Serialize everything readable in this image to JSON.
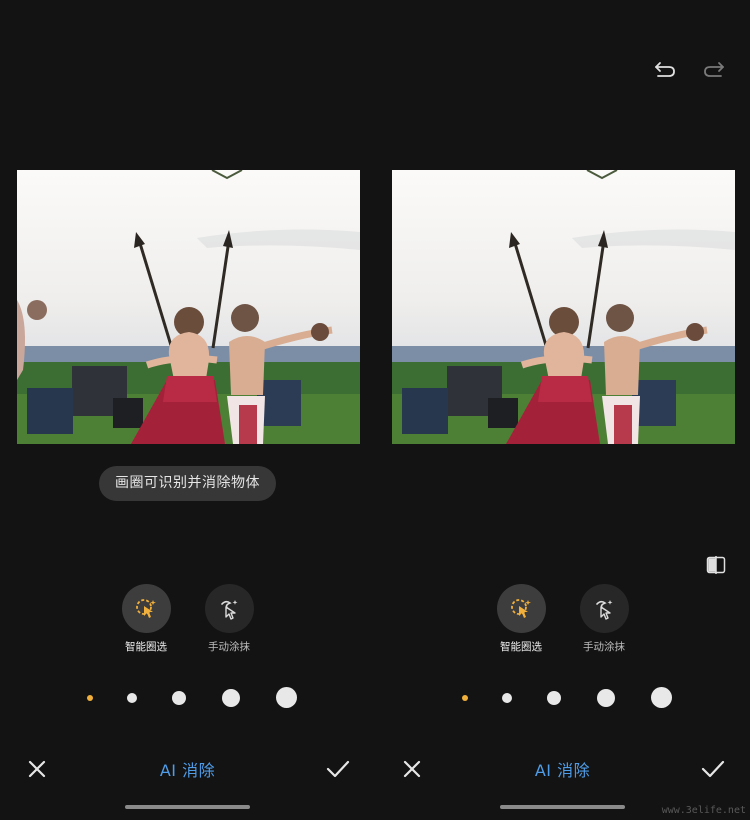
{
  "left_panel": {
    "hint": "画圈可识别并消除物体",
    "tools": [
      {
        "label": "智能圈选",
        "icon": "smart-select-icon",
        "active": true
      },
      {
        "label": "手动涂抹",
        "icon": "manual-brush-icon",
        "active": false
      }
    ],
    "title": "AI 消除",
    "brush_sizes": {
      "count": 5,
      "selected_index": 0
    }
  },
  "right_panel": {
    "tools": [
      {
        "label": "智能圈选",
        "icon": "smart-select-icon",
        "active": true
      },
      {
        "label": "手动涂抹",
        "icon": "manual-brush-icon",
        "active": false
      }
    ],
    "title": "AI 消除",
    "brush_sizes": {
      "count": 5,
      "selected_index": 0
    }
  },
  "watermark": "www.3elife.net",
  "colors": {
    "background": "#131313",
    "accent": "#f1b03c",
    "title_blue": "#4f9de8"
  },
  "icons": {
    "undo": "undo-icon",
    "redo": "redo-icon",
    "compare": "compare-icon",
    "cancel": "close-icon",
    "confirm": "check-icon"
  }
}
